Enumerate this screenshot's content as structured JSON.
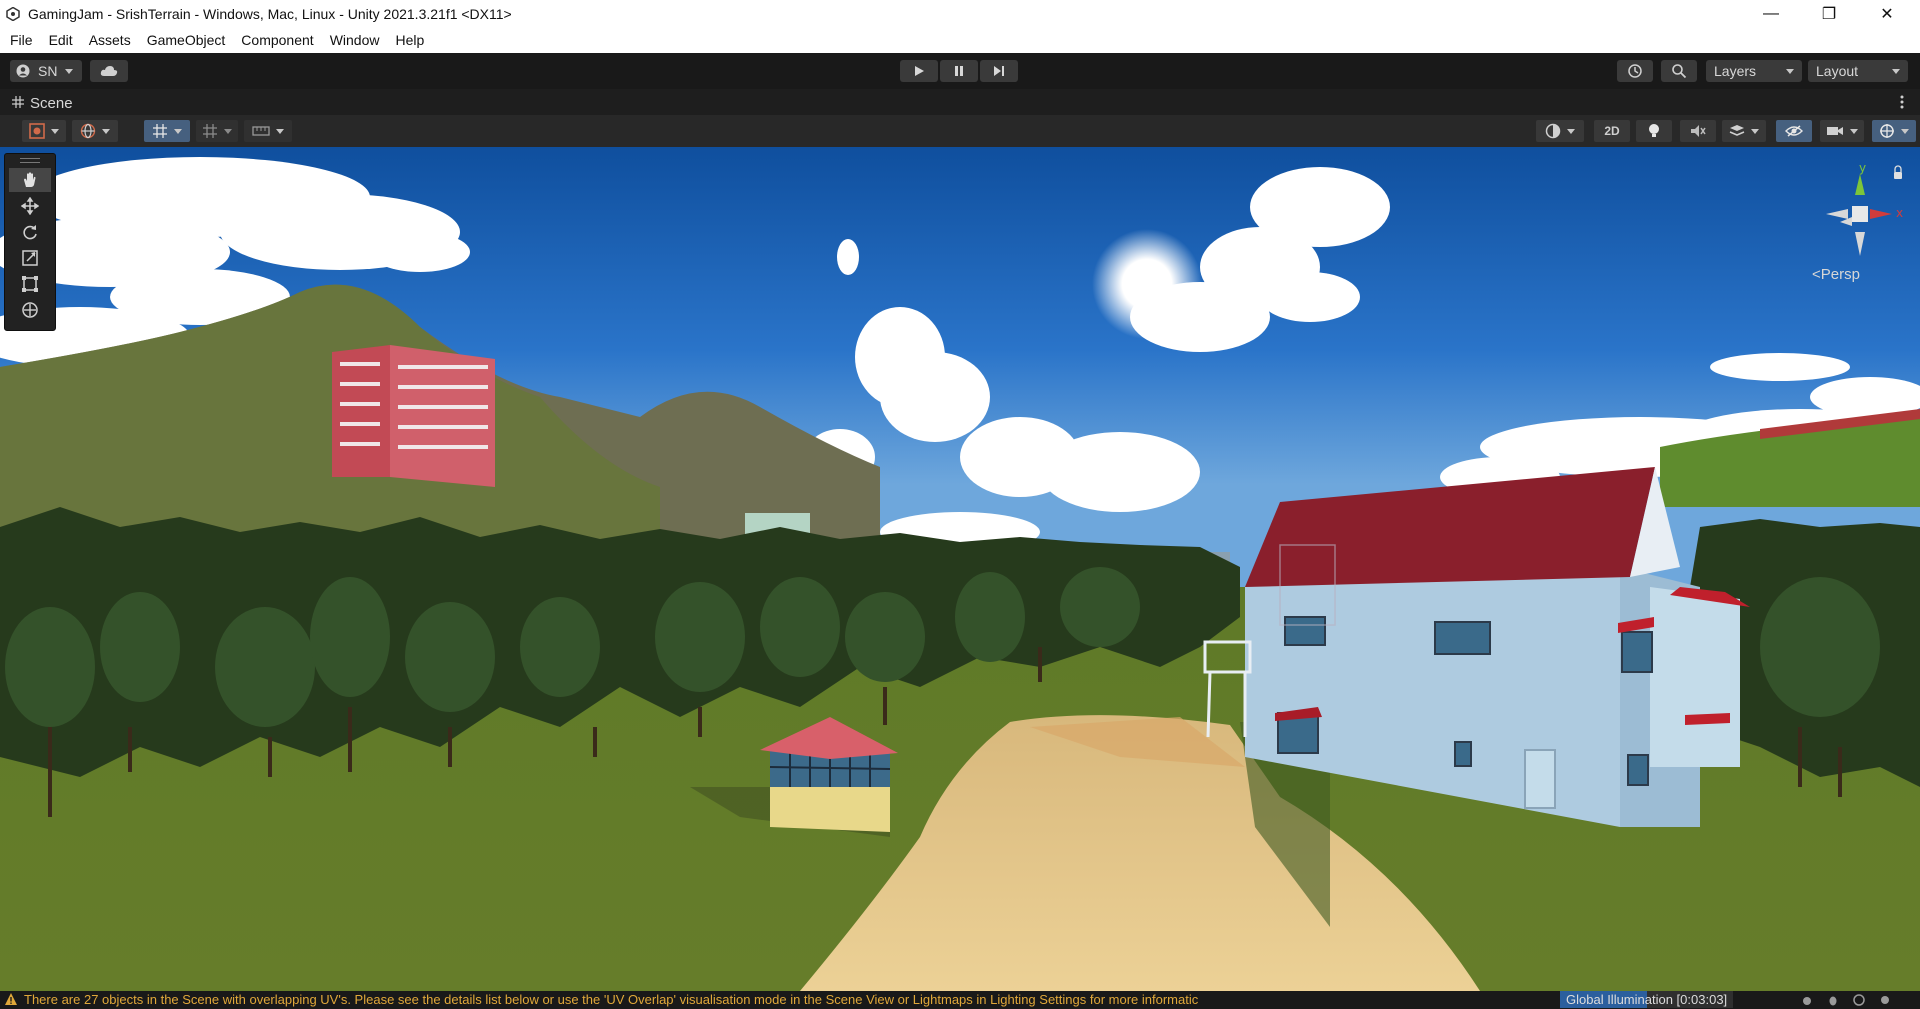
{
  "window": {
    "title": "GamingJam - SrishTerrain - Windows, Mac, Linux - Unity 2021.3.21f1 <DX11>",
    "minimize_glyph": "—",
    "maximize_glyph": "❐",
    "close_glyph": "✕"
  },
  "menu": [
    "File",
    "Edit",
    "Assets",
    "GameObject",
    "Component",
    "Window",
    "Help"
  ],
  "toolbar": {
    "account_label": "SN",
    "layers_label": "Layers",
    "layout_label": "Layout"
  },
  "scene_tab": {
    "label": "Scene"
  },
  "scene_toolbar": {
    "mode_2d_label": "2D"
  },
  "gizmo": {
    "y_label": "y",
    "x_label": "x",
    "projection_label": "Persp"
  },
  "status": {
    "warning_message": "There are 27 objects in the Scene with overlapping UV's. Please see the details list below or use the 'UV Overlap' visualisation mode in the Scene View or Lightmaps in Lighting Settings for more informatic",
    "gi_label": "Global Illumination [0:03:03]",
    "gi_progress": 0.5
  },
  "colors": {
    "accent_blue": "#2b5f9e",
    "warning": "#e0a83a",
    "axis_x": "#d23c3c",
    "axis_y": "#7cc53a",
    "roof_red": "#8a1f2c"
  }
}
